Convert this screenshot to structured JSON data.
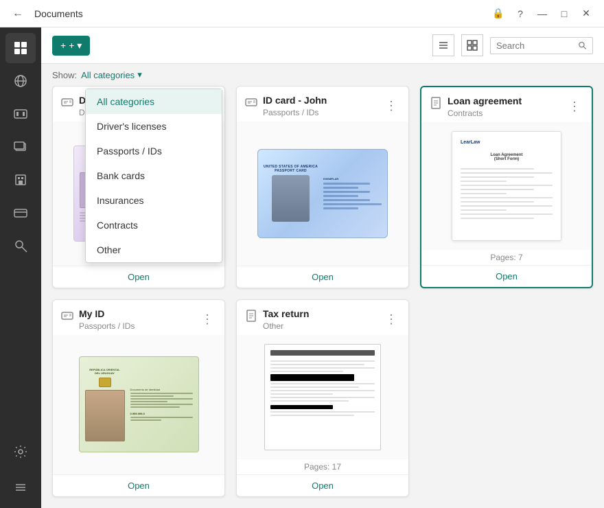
{
  "titleBar": {
    "title": "Documents",
    "backIcon": "←",
    "lockIcon": "🔒",
    "helpIcon": "?",
    "minimizeIcon": "—",
    "maximizeIcon": "□",
    "closeIcon": "✕"
  },
  "toolbar": {
    "addButton": "+ ▾",
    "viewList": "≡",
    "viewGrid": "⊞",
    "searchPlaceholder": "Search"
  },
  "filterBar": {
    "showLabel": "Show:",
    "selectedCategory": "All categories",
    "chevron": "▾"
  },
  "dropdown": {
    "items": [
      {
        "id": "all",
        "label": "All categories",
        "selected": true
      },
      {
        "id": "drivers",
        "label": "Driver's licenses",
        "selected": false
      },
      {
        "id": "passports",
        "label": "Passports / IDs",
        "selected": false
      },
      {
        "id": "bankcards",
        "label": "Bank cards",
        "selected": false
      },
      {
        "id": "insurances",
        "label": "Insurances",
        "selected": false
      },
      {
        "id": "contracts",
        "label": "Contracts",
        "selected": false
      },
      {
        "id": "other",
        "label": "Other",
        "selected": false
      }
    ]
  },
  "documents": [
    {
      "id": "drivers-license",
      "title": "Driver's license",
      "subtitle": "Driver's licenses",
      "hasOpen": true,
      "hasPages": false,
      "openLabel": "Open",
      "selected": false
    },
    {
      "id": "id-card-john",
      "title": "ID card - John",
      "subtitle": "Passports / IDs",
      "hasOpen": true,
      "hasPages": false,
      "openLabel": "Open",
      "selected": false
    },
    {
      "id": "loan-agreement",
      "title": "Loan agreement",
      "subtitle": "Contracts",
      "hasOpen": true,
      "hasPages": true,
      "pages": "Pages: 7",
      "openLabel": "Open",
      "selected": true
    },
    {
      "id": "my-id",
      "title": "My ID",
      "subtitle": "Passports / IDs",
      "hasOpen": true,
      "hasPages": false,
      "openLabel": "Open",
      "selected": false
    },
    {
      "id": "tax-return",
      "title": "Tax return",
      "subtitle": "Other",
      "hasOpen": true,
      "hasPages": true,
      "pages": "Pages: 17",
      "openLabel": "Open",
      "selected": false
    }
  ],
  "sidebarItems": [
    {
      "id": "grid",
      "icon": "⊞",
      "active": true
    },
    {
      "id": "globe",
      "icon": "🌐",
      "active": false
    },
    {
      "id": "film",
      "icon": "🎞",
      "active": false
    },
    {
      "id": "layers",
      "icon": "⧉",
      "active": false
    },
    {
      "id": "building",
      "icon": "🏢",
      "active": false
    },
    {
      "id": "card",
      "icon": "🪪",
      "active": false
    },
    {
      "id": "key",
      "icon": "🔑",
      "active": false
    },
    {
      "id": "gear",
      "icon": "⚙",
      "active": false
    },
    {
      "id": "menu",
      "icon": "≡",
      "active": false
    }
  ]
}
